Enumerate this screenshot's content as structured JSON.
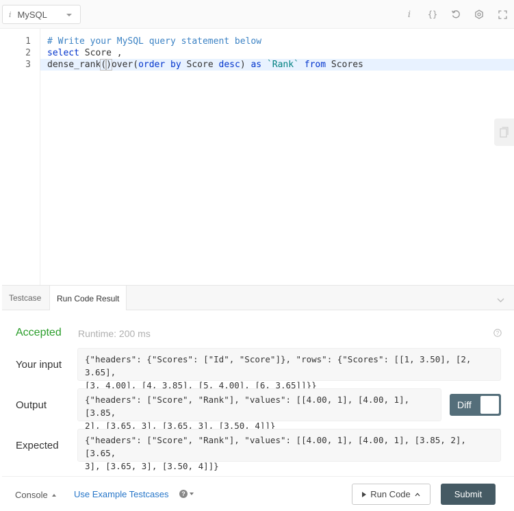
{
  "toolbar": {
    "language": "MySQL",
    "icons": [
      "info-icon",
      "braces-icon",
      "reset-icon",
      "settings-icon",
      "fullscreen-icon"
    ]
  },
  "editor": {
    "line_numbers": [
      "1",
      "2",
      "3"
    ],
    "lines": [
      "# Write your MySQL query statement below",
      "select Score ,",
      "dense_rank()over(order by Score desc) as `Rank` from Scores"
    ],
    "tokens": {
      "l3_fn": "dense_rank",
      "l3_open": "(",
      "l3_close": ")",
      "l3_over": "over",
      "l3_paren_open": "(",
      "l3_order": "order by",
      "l3_score": " Score ",
      "l3_desc": "desc",
      "l3_paren_close": ")",
      "l3_as": " as ",
      "l3_rank": "`Rank`",
      "l3_from": " from ",
      "l3_scores": "Scores",
      "l2_select": "select",
      "l2_rest": " Score ,"
    }
  },
  "tabs": [
    {
      "label": "Testcase",
      "active": false
    },
    {
      "label": "Run Code Result",
      "active": true
    }
  ],
  "result": {
    "status": "Accepted",
    "runtime": "Runtime: 200 ms",
    "input_label": "Your input",
    "input_value": "{\"headers\": {\"Scores\": [\"Id\", \"Score\"]}, \"rows\": {\"Scores\": [[1, 3.50], [2, 3.65],\n[3, 4.00], [4, 3.85], [5, 4.00], [6, 3.65]]}}",
    "output_label": "Output",
    "output_value": "{\"headers\": [\"Score\", \"Rank\"], \"values\": [[4.00, 1], [4.00, 1], [3.85,\n2], [3.65, 3], [3.65, 3], [3.50, 4]]}",
    "expected_label": "Expected",
    "expected_value": "{\"headers\": [\"Score\", \"Rank\"], \"values\": [[4.00, 1], [4.00, 1], [3.85, 2], [3.65,\n3], [3.65, 3], [3.50, 4]]}",
    "diff_label": "Diff"
  },
  "bottom": {
    "console_label": "Console",
    "example_link": "Use Example Testcases",
    "run_label": "Run Code",
    "submit_label": "Submit"
  },
  "colors": {
    "accepted": "#2a9d2a",
    "submit_bg": "#455a64",
    "link": "#2575c8",
    "keyword": "#0033cc",
    "comment": "#3b82c4"
  }
}
